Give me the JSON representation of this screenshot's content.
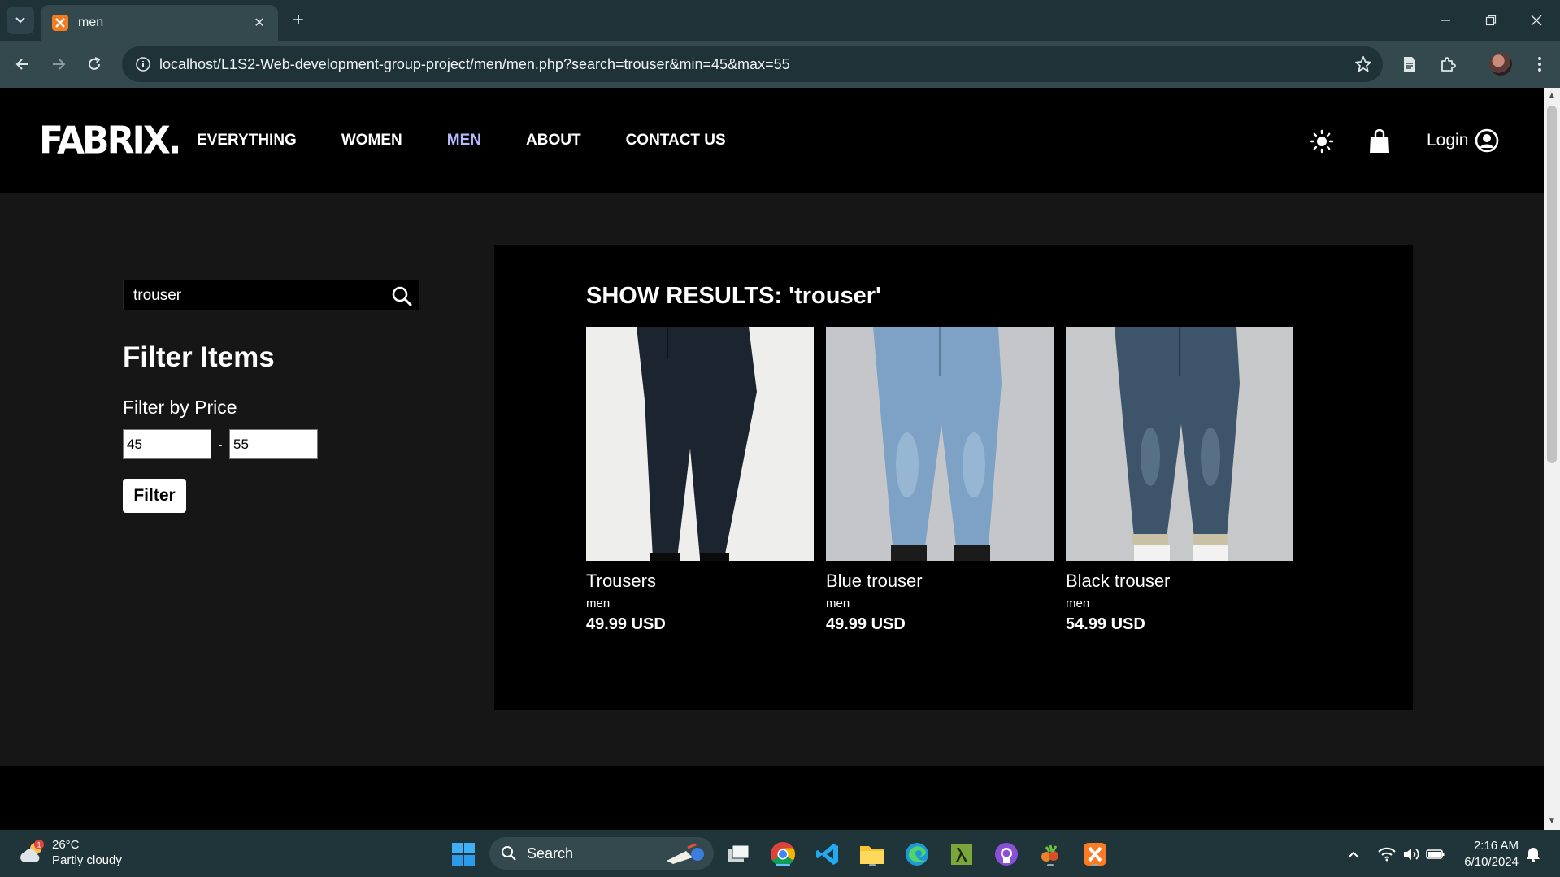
{
  "browser": {
    "tab_title": "men",
    "url": "localhost/L1S2-Web-development-group-project/men/men.php?search=trouser&min=45&max=55"
  },
  "header": {
    "logo": "FABRIX.",
    "nav": [
      "EVERYTHING",
      "WOMEN",
      "MEN",
      "ABOUT",
      "CONTACT US"
    ],
    "active_nav": "MEN",
    "login_label": "Login"
  },
  "sidebar": {
    "search_value": "trouser",
    "filter_title": "Filter Items",
    "price_label": "Filter by Price",
    "min_value": "45",
    "price_separator": "-",
    "max_value": "55",
    "filter_button": "Filter"
  },
  "results": {
    "title": "SHOW RESULTS: 'trouser'",
    "products": [
      {
        "name": "Trousers",
        "category": "men",
        "price": "49.99 USD",
        "denim_color": "#1c2430"
      },
      {
        "name": "Blue trouser",
        "category": "men",
        "price": "49.99 USD",
        "denim_color": "#7ea2c6"
      },
      {
        "name": "Black trouser",
        "category": "men",
        "price": "54.99 USD",
        "denim_color": "#3d546b"
      }
    ]
  },
  "taskbar": {
    "weather_temp": "26°C",
    "weather_desc": "Partly cloudy",
    "weather_badge": "1",
    "search_label": "Search",
    "time": "2:16 AM",
    "date": "6/10/2024"
  },
  "colors": {
    "active_nav": "#b6b8ff",
    "page_bg": "#161616",
    "chrome_bg": "#1e3237"
  }
}
